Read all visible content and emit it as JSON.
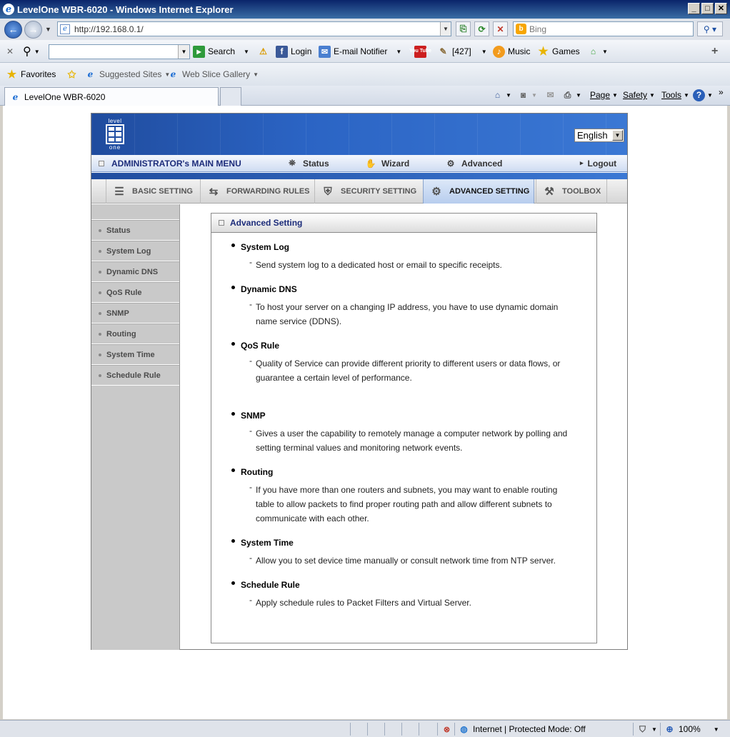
{
  "window": {
    "title": "LevelOne WBR-6020 - Windows Internet Explorer"
  },
  "address": {
    "url": "http://192.168.0.1/",
    "search_placeholder": "Bing"
  },
  "toolbar": {
    "search_label": "Search",
    "login_label": "Login",
    "email_label": "E-mail Notifier",
    "youtube_label": "You Tube",
    "count_label": "[427]",
    "music_label": "Music",
    "games_label": "Games"
  },
  "favorites": {
    "favorites_label": "Favorites",
    "suggested_label": "Suggested Sites",
    "webslice_label": "Web Slice Gallery"
  },
  "tabs": {
    "active_title": "LevelOne WBR-6020"
  },
  "commands": {
    "page": "Page",
    "safety": "Safety",
    "tools": "Tools"
  },
  "router": {
    "logo_top": "level",
    "logo_bottom": "one",
    "language": "English",
    "main_menu": {
      "admin": "ADMINISTRATOR's MAIN MENU",
      "status": "Status",
      "wizard": "Wizard",
      "advanced": "Advanced",
      "logout": "Logout"
    },
    "tabs": [
      "BASIC SETTING",
      "FORWARDING RULES",
      "SECURITY SETTING",
      "ADVANCED SETTING",
      "TOOLBOX"
    ],
    "sidebar": [
      "Status",
      "System Log",
      "Dynamic DNS",
      "QoS Rule",
      "SNMP",
      "Routing",
      "System Time",
      "Schedule Rule"
    ],
    "panel_title": "Advanced Setting",
    "entries": [
      {
        "title": "System Log",
        "lines": [
          "Send system log to a dedicated host or email to specific receipts."
        ]
      },
      {
        "title": "Dynamic DNS",
        "lines": [
          "To host your server on a changing IP address, you have to use dynamic domain",
          "name service (DDNS)."
        ]
      },
      {
        "title": "QoS Rule",
        "lines": [
          "Quality of Service can provide different priority to different users or data flows, or",
          "guarantee a certain level of performance."
        ]
      },
      {
        "title": "SNMP",
        "lines": [
          "Gives a user the capability to remotely manage a computer network by polling and",
          "setting terminal values and monitoring network events."
        ]
      },
      {
        "title": "Routing",
        "lines": [
          "If you have more than one routers and subnets, you may want to enable routing",
          "table to allow packets to find proper routing path and allow different subnets to",
          "communicate with each other."
        ]
      },
      {
        "title": "System Time",
        "lines": [
          "Allow you to set device time manually or consult network time from NTP server."
        ]
      },
      {
        "title": "Schedule Rule",
        "lines": [
          "Apply schedule rules to Packet Filters and Virtual Server."
        ]
      }
    ]
  },
  "status": {
    "zone": "Internet | Protected Mode: Off",
    "zoom": "100%"
  },
  "colors": {
    "accent": "#2b64c4",
    "menu_text": "#1c2c7a"
  }
}
